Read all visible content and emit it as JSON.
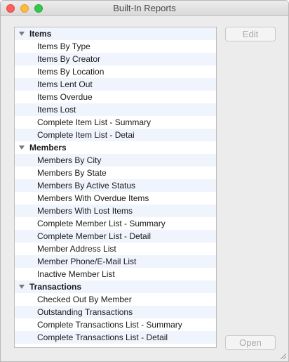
{
  "window": {
    "title": "Built-In Reports"
  },
  "groups": [
    {
      "label": "Items",
      "items": [
        "Items By Type",
        "Items By Creator",
        "Items By Location",
        "Items Lent Out",
        "Items Overdue",
        "Items Lost",
        "Complete Item List - Summary",
        "Complete Item List - Detai"
      ]
    },
    {
      "label": "Members",
      "items": [
        "Members By City",
        "Members By State",
        "Members By Active Status",
        "Members With Overdue Items",
        "Members With Lost Items",
        "Complete Member List - Summary",
        "Complete Member List - Detail",
        "Member Address List",
        "Member Phone/E-Mail List",
        "Inactive Member List"
      ]
    },
    {
      "label": "Transactions",
      "items": [
        "Checked Out By Member",
        "Outstanding Transactions",
        "Complete Transactions List - Summary",
        "Complete Transactions List - Detail"
      ]
    }
  ],
  "buttons": {
    "edit": "Edit",
    "open": "Open"
  },
  "colors": {
    "alt_row": "#f0f4fc",
    "close": "#fc605c",
    "minimize": "#fdbc40",
    "maximize": "#34c84a"
  }
}
